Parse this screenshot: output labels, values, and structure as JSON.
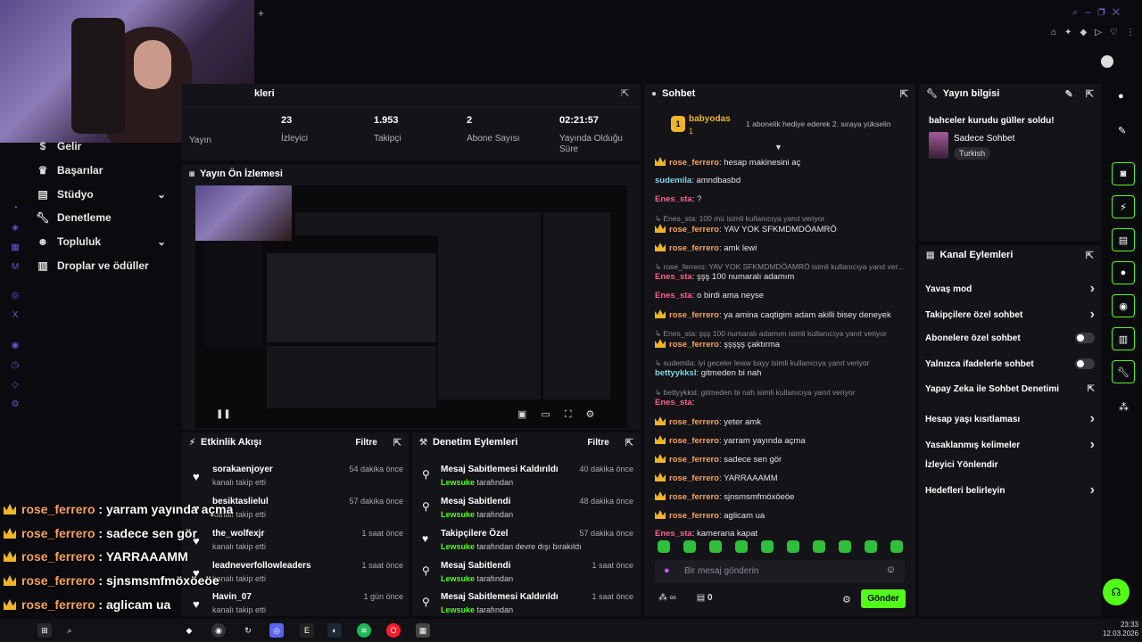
{
  "stats": {
    "items": [
      {
        "value": "",
        "label": "Yayın"
      },
      {
        "value": "23",
        "label": "İzleyici"
      },
      {
        "value": "1.953",
        "label": "Takipçi"
      },
      {
        "value": "2",
        "label": "Abone Sayısı"
      },
      {
        "value": "02:21:57",
        "label": "Yayında Olduğu Süre"
      }
    ],
    "header_partial": "kleri"
  },
  "nav": {
    "items": [
      {
        "label": "Gelir",
        "icon": "dollar-icon"
      },
      {
        "label": "Başarılar",
        "icon": "trophy-icon"
      },
      {
        "label": "Stüdyo",
        "icon": "studio-icon"
      },
      {
        "label": "Denetleme",
        "icon": "wrench-icon"
      },
      {
        "label": "Topluluk",
        "icon": "users-icon"
      },
      {
        "label": "Droplar ve ödüller",
        "icon": "gift-icon"
      }
    ]
  },
  "preview": {
    "title": "Yayın Ön İzlemesi"
  },
  "activity": {
    "title": "Etkinlik Akışı",
    "filter": "Filtre",
    "items": [
      {
        "name": "sorakaenjoyer",
        "sub": "kanalı takip etti",
        "time": "54 dakika önce"
      },
      {
        "name": "besiktaslielul",
        "sub": "kanalı takip etti",
        "time": "57 dakika önce"
      },
      {
        "name": "the_wolfexjr",
        "sub": "kanalı takip etti",
        "time": "1 saat önce"
      },
      {
        "name": "leadneverfollowleaders",
        "sub": "kanalı takip etti",
        "time": "1 saat önce"
      },
      {
        "name": "Havin_07",
        "sub": "kanalı takip etti",
        "time": "1 gün önce"
      }
    ]
  },
  "moderation": {
    "title": "Denetim Eylemleri",
    "filter": "Filtre",
    "items": [
      {
        "name": "Mesaj Sabitlemesi Kaldırıldı",
        "who": "Lewsuke",
        "sub": "tarafından",
        "time": "40 dakika önce"
      },
      {
        "name": "Mesaj Sabitlendi",
        "who": "Lewsuke",
        "sub": "tarafından",
        "time": "48 dakika önce"
      },
      {
        "name": "Takipçilere Özel",
        "who": "Lewsuke",
        "sub": "tarafından devre dışı bırakıldı",
        "time": "57 dakika önce"
      },
      {
        "name": "Mesaj Sabitlendi",
        "who": "Lewsuke",
        "sub": "tarafından",
        "time": "1 saat önce"
      },
      {
        "name": "Mesaj Sabitlemesi Kaldırıldı",
        "who": "Lewsuke",
        "sub": "tarafından",
        "time": "1 saat önce"
      }
    ]
  },
  "chat": {
    "title": "Sohbet",
    "pinned_user": "babyodas",
    "pinned_count": "1",
    "pinned_text": "1 abonelik hediye ederek 2. sıraya yükselin",
    "messages": [
      {
        "kind": "msg",
        "user": "rose_ferrero",
        "cls": "u-rose",
        "crown": true,
        "text": "hesap makinesini aç"
      },
      {
        "kind": "msg",
        "user": "sudemila",
        "cls": "u-sud",
        "crown": false,
        "text": "amndbasbd"
      },
      {
        "kind": "msg",
        "user": "Enes_sta",
        "cls": "u-enes",
        "crown": false,
        "text": "?"
      },
      {
        "kind": "reply",
        "text": "↳ Enes_sta: 100 mü isimli kullanıcıya yanıt veriyor"
      },
      {
        "kind": "msg",
        "user": "rose_ferrero",
        "cls": "u-rose",
        "crown": true,
        "text": "YAV YOK SFKMDMDÖAMRÖ"
      },
      {
        "kind": "msg",
        "user": "rose_ferrero",
        "cls": "u-rose",
        "crown": true,
        "text": "amk lewi"
      },
      {
        "kind": "reply",
        "text": "↳ rose_ferrero: YAV YOK SFKMDMDÖAMRÖ isimli kullanıcıya yanıt ver..."
      },
      {
        "kind": "msg",
        "user": "Enes_sta",
        "cls": "u-enes",
        "crown": false,
        "text": "şşş 100 numaralı adamım"
      },
      {
        "kind": "msg",
        "user": "Enes_sta",
        "cls": "u-enes",
        "crown": false,
        "text": "o birdi ama neyse"
      },
      {
        "kind": "msg",
        "user": "rose_ferrero",
        "cls": "u-rose",
        "crown": true,
        "text": "ya amina caqtigim adam akilli bisey deneyek"
      },
      {
        "kind": "reply",
        "text": "↳ Enes_sta: şşş 100 numaralı adamım isimli kullanıcıya yanıt veriyor"
      },
      {
        "kind": "msg",
        "user": "rose_ferrero",
        "cls": "u-rose",
        "crown": true,
        "text": "şşşşş çaktırma"
      },
      {
        "kind": "reply",
        "text": "↳ sudemila: iyi geceler leww bayy isimli kullanıcıya yanıt veriyor"
      },
      {
        "kind": "msg",
        "user": "bettyykksl",
        "cls": "u-betty",
        "crown": false,
        "text": "gitmeden bi nah"
      },
      {
        "kind": "reply",
        "text": "↳ bettyykksl: gitmeden bi nah isimli kullanıcıya yanıt veriyor"
      },
      {
        "kind": "msg",
        "user": "Enes_sta",
        "cls": "u-enes",
        "crown": false,
        "text": ""
      },
      {
        "kind": "msg",
        "user": "rose_ferrero",
        "cls": "u-rose",
        "crown": true,
        "text": "yeter amk"
      },
      {
        "kind": "msg",
        "user": "rose_ferrero",
        "cls": "u-rose",
        "crown": true,
        "text": "yarram yayında açma"
      },
      {
        "kind": "msg",
        "user": "rose_ferrero",
        "cls": "u-rose",
        "crown": true,
        "text": "sadece sen gör"
      },
      {
        "kind": "msg",
        "user": "rose_ferrero",
        "cls": "u-rose",
        "crown": true,
        "text": "YARRAAAMM"
      },
      {
        "kind": "msg",
        "user": "rose_ferrero",
        "cls": "u-rose",
        "crown": true,
        "text": "sjnsmsmfmöxöeöe"
      },
      {
        "kind": "msg",
        "user": "rose_ferrero",
        "cls": "u-rose",
        "crown": true,
        "text": "aglicam ua"
      },
      {
        "kind": "msg",
        "user": "Enes_sta",
        "cls": "u-enes",
        "crown": false,
        "text": "kamerana kapat"
      }
    ],
    "placeholder": "Bir mesaj gönderin",
    "send": "Gönder",
    "points": "0",
    "infinity": "∞"
  },
  "stream_info": {
    "title": "Yayın bilgisi",
    "stream_title": "bahceler kurudu güller soldu!",
    "category": "Sadece Sohbet",
    "tag": "Turkish"
  },
  "channel_actions": {
    "title": "Kanal Eylemleri",
    "items": [
      {
        "label": "Yavaş mod",
        "ctrl": "chevron"
      },
      {
        "label": "Takipçilere özel sohbet",
        "ctrl": "chevron"
      },
      {
        "label": "Abonelere özel sohbet",
        "ctrl": "toggle"
      },
      {
        "label": "Yalnızca ifadelerle sohbet",
        "ctrl": "toggle"
      },
      {
        "label": "Yapay Zeka ile Sohbet Denetimi",
        "ctrl": "external"
      },
      {
        "label": "Hesap yaşı kısıtlaması",
        "ctrl": "chevron"
      },
      {
        "label": "Yasaklanmış kelimeler",
        "ctrl": "chevron"
      },
      {
        "label": "İzleyici Yönlendir",
        "ctrl": "none"
      },
      {
        "label": "Hedefleri belirleyin",
        "ctrl": "chevron"
      }
    ]
  },
  "overlay_chat": [
    {
      "user": "rose_ferrero",
      "sep": " : ",
      "text": "yarram yayında açma",
      "crown": true
    },
    {
      "user": "rose_ferrero",
      "sep": " : ",
      "text": "sadece sen gör",
      "crown": true
    },
    {
      "user": "rose_ferrero",
      "sep": " : ",
      "text": "YARRAAAMM",
      "crown": true
    },
    {
      "user": "rose_ferrero",
      "sep": " : ",
      "text": "sjnsmsmfmöxöeöe",
      "crown": true
    },
    {
      "user": "rose_ferrero",
      "sep": " : ",
      "text": "aglicam ua",
      "crown": true
    },
    {
      "user": "Enes_sta",
      "sep": " : ",
      "text": "kamerana kapat",
      "crown": false
    }
  ],
  "clock": {
    "time": "23:33",
    "date": "12.03.2026"
  },
  "colors": {
    "accent": "#53fc18",
    "crown": "#f0b429",
    "panel": "#131318"
  }
}
